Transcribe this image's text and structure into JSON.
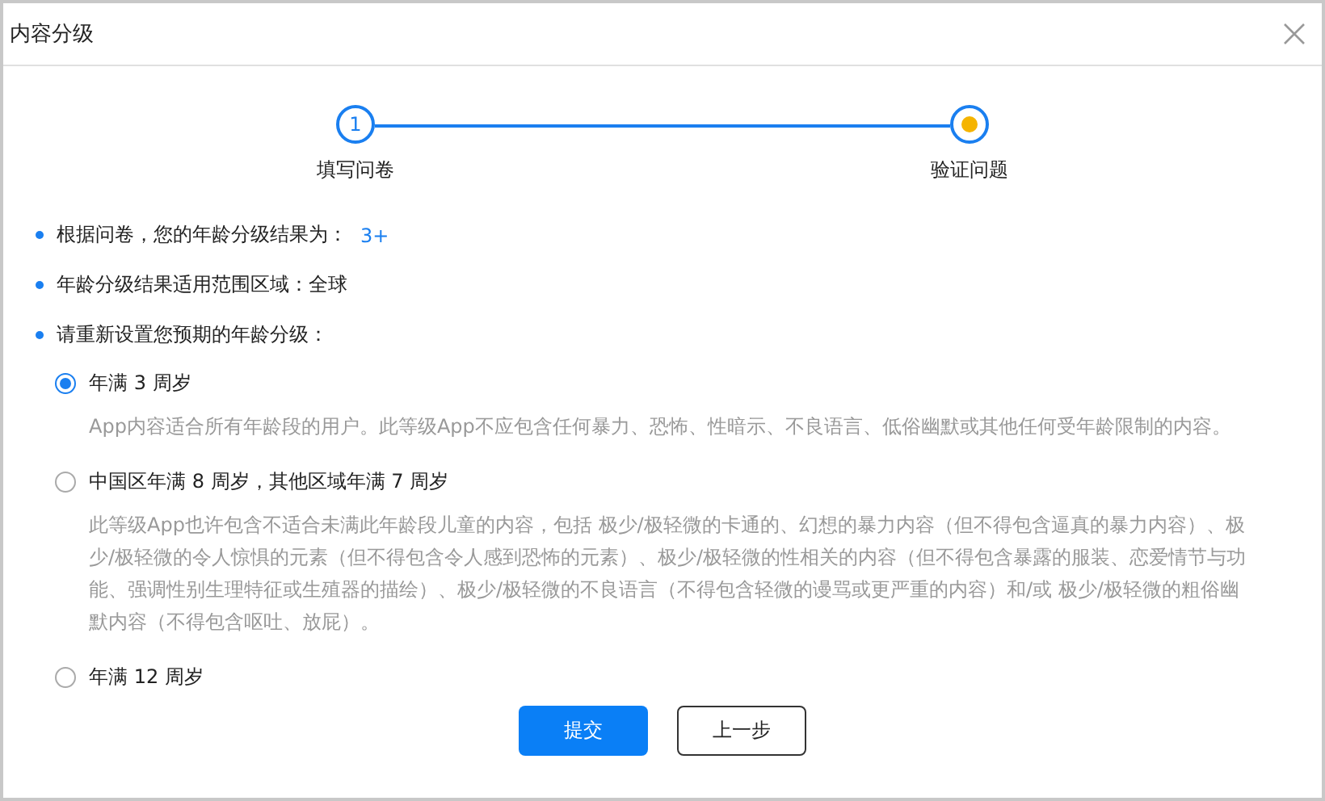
{
  "dialog": {
    "title": "内容分级"
  },
  "steps": [
    {
      "number": "1",
      "label": "填写问卷",
      "kind": "done"
    },
    {
      "label": "验证问题",
      "kind": "current"
    }
  ],
  "bullets": [
    {
      "text": "根据问卷，您的年龄分级结果为：",
      "value": "3+"
    },
    {
      "text": "年龄分级结果适用范围区域：全球"
    },
    {
      "text": "请重新设置您预期的年龄分级："
    }
  ],
  "options": [
    {
      "label": "年满 3 周岁",
      "selected": true,
      "description": "App内容适合所有年龄段的用户。此等级App不应包含任何暴力、恐怖、性暗示、不良语言、低俗幽默或其他任何受年龄限制的内容。"
    },
    {
      "label": "中国区年满 8 周岁，其他区域年满 7 周岁",
      "selected": false,
      "description": "此等级App也许包含不适合未满此年龄段儿童的内容，包括 极少/极轻微的卡通的、幻想的暴力内容（但不得包含逼真的暴力内容）、极少/极轻微的令人惊惧的元素（但不得包含令人感到恐怖的元素）、极少/极轻微的性相关的内容（但不得包含暴露的服装、恋爱情节与功能、强调性别生理特征或生殖器的描绘）、极少/极轻微的不良语言（不得包含轻微的谩骂或更严重的内容）和/或 极少/极轻微的粗俗幽默内容（不得包含呕吐、放屁）。"
    },
    {
      "label": "年满 12 周岁",
      "selected": false
    }
  ],
  "buttons": [
    {
      "label": "提交",
      "kind": "primary"
    },
    {
      "label": "上一步",
      "kind": "secondary"
    }
  ]
}
